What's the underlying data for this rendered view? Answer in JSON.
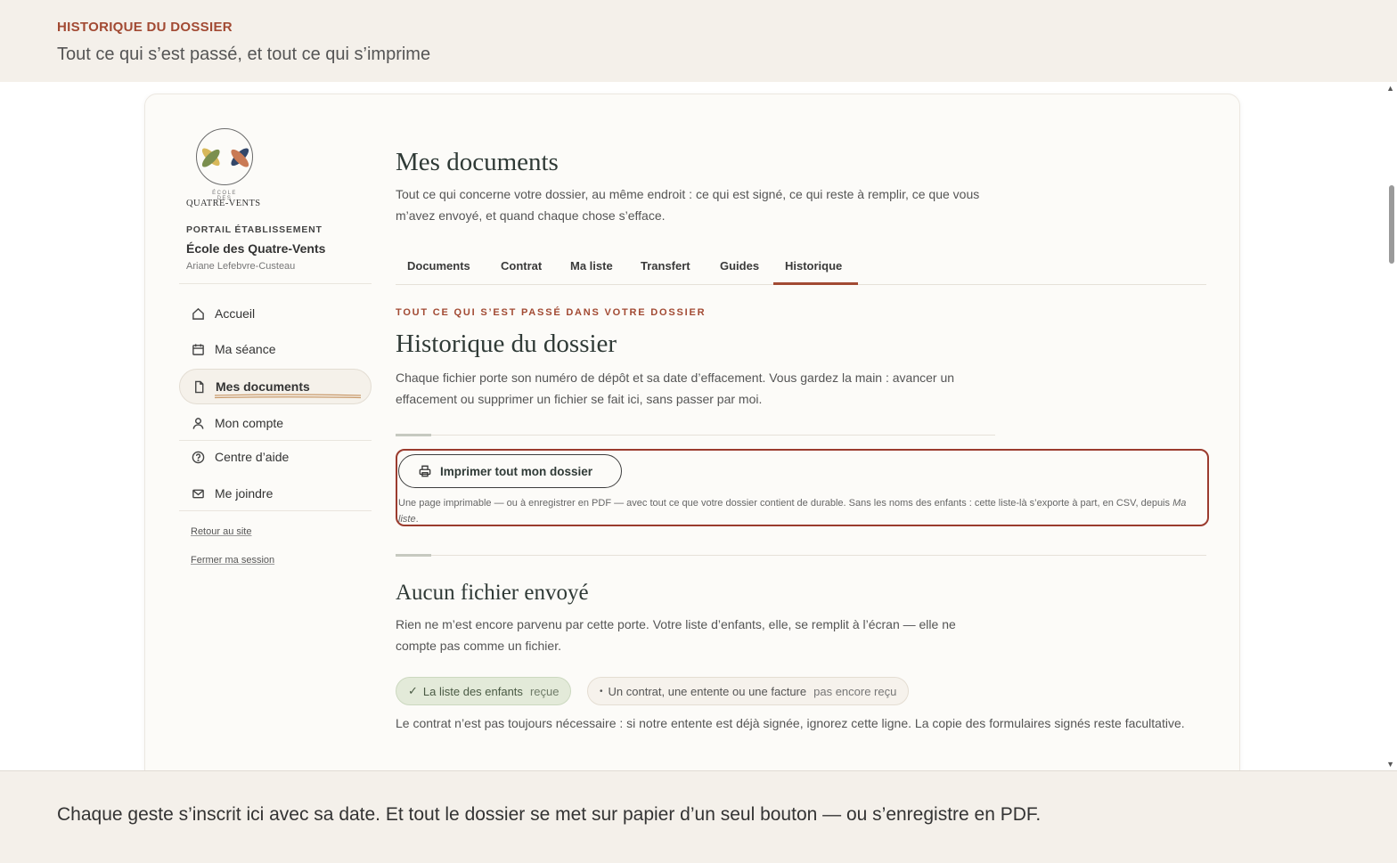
{
  "header": {
    "kicker": "HISTORIQUE DU DOSSIER",
    "subtitle": "Tout ce qui s’est passé, et tout ce qui s’imprime"
  },
  "sidebar": {
    "logo_small": "École des",
    "logo_name": "QUATRE-VENTS",
    "portal_label": "PORTAIL ÉTABLISSEMENT",
    "school_name": "École des Quatre-Vents",
    "user_name": "Ariane Lefebvre-Custeau",
    "items": [
      {
        "label": "Accueil",
        "icon": "home-icon"
      },
      {
        "label": "Ma séance",
        "icon": "calendar-icon"
      },
      {
        "label": "Mes documents",
        "icon": "document-icon",
        "active": true
      },
      {
        "label": "Mon compte",
        "icon": "user-icon"
      },
      {
        "label": "Centre d’aide",
        "icon": "help-icon"
      },
      {
        "label": "Me joindre",
        "icon": "mail-icon"
      }
    ],
    "links": [
      "Retour au site",
      "Fermer ma session"
    ]
  },
  "main": {
    "title": "Mes documents",
    "description": "Tout ce qui concerne votre dossier, au même endroit : ce qui est signé, ce qui reste à remplir, ce que vous m’avez envoyé, et quand chaque chose s’efface.",
    "tabs": [
      "Documents",
      "Contrat",
      "Ma liste",
      "Transfert",
      "Guides",
      "Historique"
    ],
    "active_tab": "Historique",
    "section_kicker": "TOUT CE QUI S’EST PASSÉ DANS VOTRE DOSSIER",
    "section_title": "Historique du dossier",
    "section_text": "Chaque fichier porte son numéro de dépôt et sa date d’effacement. Vous gardez la main : avancer un effacement ou supprimer un fichier se fait ici, sans passer par moi.",
    "print_button": "Imprimer tout mon dossier",
    "print_note_a": "Une page imprimable — ou à enregistrer en PDF — avec tout ce que votre dossier contient de durable. Sans les noms des enfants : cette liste-là s’exporte à part, en CSV, depuis ",
    "print_note_em": "Ma liste",
    "print_note_b": ".",
    "empty_title": "Aucun fichier envoyé",
    "empty_text": "Rien ne m’est encore parvenu par cette porte. Votre liste d’enfants, elle, se remplit à l’écran — elle ne compte pas comme un fichier.",
    "chips": [
      {
        "mark": "✓",
        "label": "La liste des enfants",
        "status": "reçue"
      },
      {
        "mark": "•",
        "label": "Un contrat, une entente ou une facture",
        "status": "pas encore reçu"
      }
    ],
    "footnote": "Le contrat n’est pas toujours nécessaire : si notre entente est déjà signée, ignorez cette ligne. La copie des formulaires signés reste facultative."
  },
  "footer": {
    "caption": "Chaque geste s’inscrit ici avec sa date. Et tout le dossier se met sur papier d’un seul bouton — ou s’enregistre en PDF."
  },
  "colors": {
    "accent": "#a24a33",
    "highlight_border": "#9b3b2e",
    "chip_ok_bg": "#e3ead9",
    "background": "#f4f0ea"
  }
}
